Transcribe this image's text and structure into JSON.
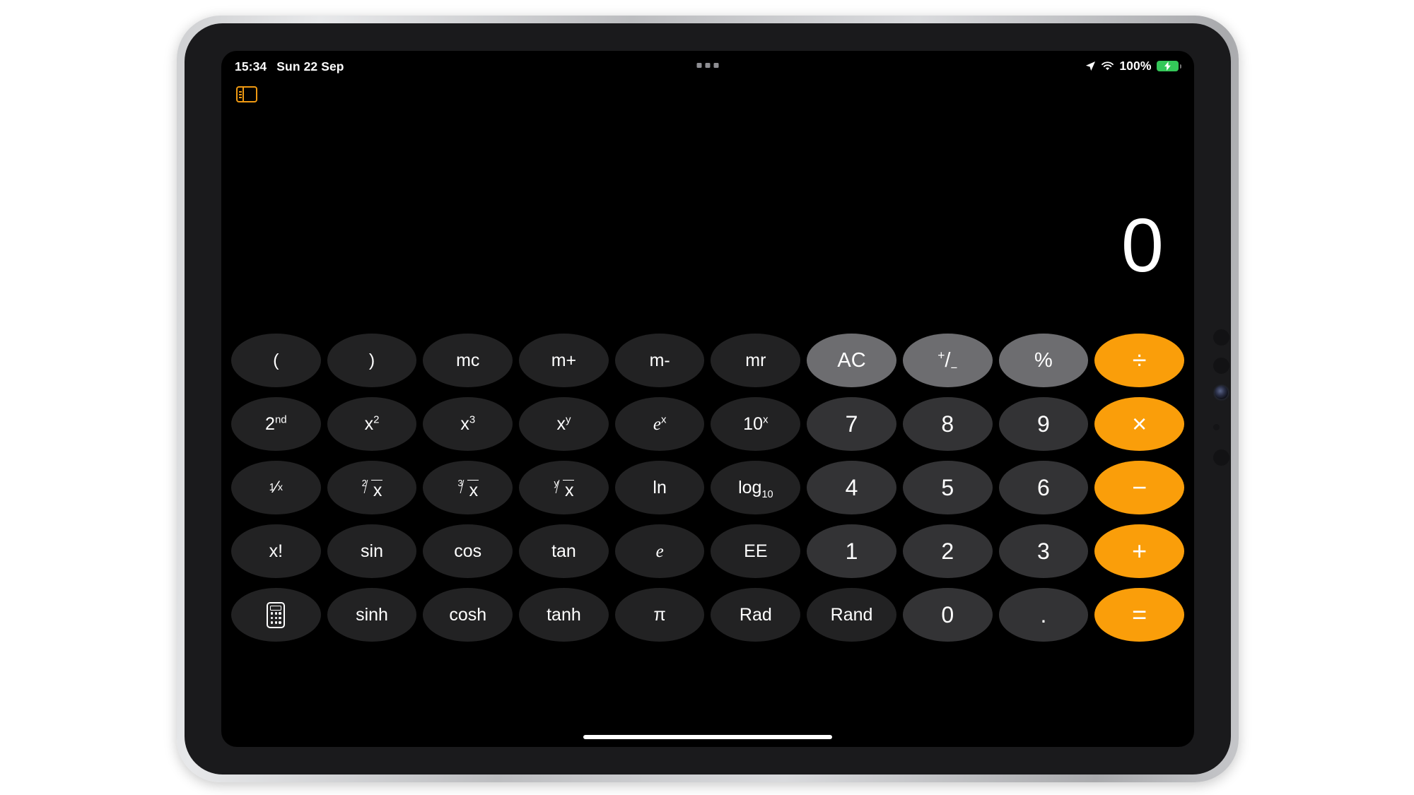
{
  "device": {
    "name": "iPad",
    "frame_color": "#c8c9cc",
    "bezel_color": "#1a1a1c"
  },
  "status_bar": {
    "time": "15:34",
    "date": "Sun 22 Sep",
    "location_icon": "location-arrow-icon",
    "wifi_icon": "wifi-icon",
    "battery_percent": "100%",
    "battery_icon": "battery-charging-icon",
    "battery_color": "#34c759",
    "multitasking_icon": "multitasking-dots-icon"
  },
  "stage_manager": {
    "icon": "sidebar-split-view-icon",
    "color": "#f09a12"
  },
  "app": {
    "name": "Calculator",
    "mode": "scientific",
    "display_value": "0",
    "accent_color": "#fa9e0a",
    "function_key_color": "#222223",
    "number_key_color": "#333335",
    "utility_key_color": "#6d6d70"
  },
  "keypad": {
    "rows": [
      [
        {
          "name": "open-paren",
          "label": "(",
          "kind": "fn",
          "glyph": "text"
        },
        {
          "name": "close-paren",
          "label": ")",
          "kind": "fn",
          "glyph": "text"
        },
        {
          "name": "memory-clear",
          "label": "mc",
          "kind": "fn",
          "glyph": "text"
        },
        {
          "name": "memory-add",
          "label": "m+",
          "kind": "fn",
          "glyph": "text"
        },
        {
          "name": "memory-subtract",
          "label": "m-",
          "kind": "fn",
          "glyph": "text"
        },
        {
          "name": "memory-recall",
          "label": "mr",
          "kind": "fn",
          "glyph": "text"
        },
        {
          "name": "all-clear",
          "label": "AC",
          "kind": "util",
          "glyph": "text"
        },
        {
          "name": "plus-minus",
          "label": "+/-",
          "kind": "util",
          "glyph": "plusminus"
        },
        {
          "name": "percent",
          "label": "%",
          "kind": "util",
          "glyph": "text"
        },
        {
          "name": "divide",
          "label": "÷",
          "kind": "op",
          "glyph": "text"
        }
      ],
      [
        {
          "name": "second-function",
          "label": "2nd",
          "kind": "fn",
          "glyph": "sup",
          "base": "2",
          "exp": "nd"
        },
        {
          "name": "x-squared",
          "label": "x2",
          "kind": "fn",
          "glyph": "sup",
          "base": "x",
          "exp": "2"
        },
        {
          "name": "x-cubed",
          "label": "x3",
          "kind": "fn",
          "glyph": "sup",
          "base": "x",
          "exp": "3"
        },
        {
          "name": "x-to-the-y",
          "label": "xy",
          "kind": "fn",
          "glyph": "sup",
          "base": "x",
          "exp": "y"
        },
        {
          "name": "e-to-the-x",
          "label": "ex",
          "kind": "fn",
          "glyph": "supital",
          "base": "e",
          "exp": "x"
        },
        {
          "name": "ten-to-the-x",
          "label": "10x",
          "kind": "fn",
          "glyph": "sup",
          "base": "10",
          "exp": "x"
        },
        {
          "name": "digit-7",
          "label": "7",
          "kind": "num",
          "glyph": "text"
        },
        {
          "name": "digit-8",
          "label": "8",
          "kind": "num",
          "glyph": "text"
        },
        {
          "name": "digit-9",
          "label": "9",
          "kind": "num",
          "glyph": "text"
        },
        {
          "name": "multiply",
          "label": "×",
          "kind": "op",
          "glyph": "text"
        }
      ],
      [
        {
          "name": "reciprocal",
          "label": "1/x",
          "kind": "fn",
          "glyph": "recip"
        },
        {
          "name": "square-root",
          "label": "2√x",
          "kind": "fn",
          "glyph": "radical",
          "idx": "2",
          "arg": "x"
        },
        {
          "name": "cube-root",
          "label": "3√x",
          "kind": "fn",
          "glyph": "radical",
          "idx": "3",
          "arg": "x"
        },
        {
          "name": "y-root-x",
          "label": "y√x",
          "kind": "fn",
          "glyph": "radical",
          "idx": "y",
          "arg": "x"
        },
        {
          "name": "natural-log",
          "label": "ln",
          "kind": "fn",
          "glyph": "text"
        },
        {
          "name": "log-base-10",
          "label": "log10",
          "kind": "fn",
          "glyph": "sub",
          "base": "log",
          "idx": "10"
        },
        {
          "name": "digit-4",
          "label": "4",
          "kind": "num",
          "glyph": "text"
        },
        {
          "name": "digit-5",
          "label": "5",
          "kind": "num",
          "glyph": "text"
        },
        {
          "name": "digit-6",
          "label": "6",
          "kind": "num",
          "glyph": "text"
        },
        {
          "name": "subtract",
          "label": "−",
          "kind": "op",
          "glyph": "text"
        }
      ],
      [
        {
          "name": "factorial",
          "label": "x!",
          "kind": "fn",
          "glyph": "text"
        },
        {
          "name": "sine",
          "label": "sin",
          "kind": "fn",
          "glyph": "text"
        },
        {
          "name": "cosine",
          "label": "cos",
          "kind": "fn",
          "glyph": "text"
        },
        {
          "name": "tangent",
          "label": "tan",
          "kind": "fn",
          "glyph": "text"
        },
        {
          "name": "euler-number",
          "label": "e",
          "kind": "fn",
          "glyph": "ital"
        },
        {
          "name": "exponent-ee",
          "label": "EE",
          "kind": "fn",
          "glyph": "text"
        },
        {
          "name": "digit-1",
          "label": "1",
          "kind": "num",
          "glyph": "text"
        },
        {
          "name": "digit-2",
          "label": "2",
          "kind": "num",
          "glyph": "text"
        },
        {
          "name": "digit-3",
          "label": "3",
          "kind": "num",
          "glyph": "text"
        },
        {
          "name": "add",
          "label": "+",
          "kind": "op",
          "glyph": "text"
        }
      ],
      [
        {
          "name": "basic-calculator-mode",
          "label": "calculator",
          "kind": "fn",
          "glyph": "calcicon"
        },
        {
          "name": "hyperbolic-sine",
          "label": "sinh",
          "kind": "fn",
          "glyph": "text"
        },
        {
          "name": "hyperbolic-cosine",
          "label": "cosh",
          "kind": "fn",
          "glyph": "text"
        },
        {
          "name": "hyperbolic-tangent",
          "label": "tanh",
          "kind": "fn",
          "glyph": "text"
        },
        {
          "name": "pi",
          "label": "π",
          "kind": "fn",
          "glyph": "text"
        },
        {
          "name": "radians-toggle",
          "label": "Rad",
          "kind": "fn",
          "glyph": "text"
        },
        {
          "name": "random",
          "label": "Rand",
          "kind": "fn",
          "glyph": "text"
        },
        {
          "name": "digit-0",
          "label": "0",
          "kind": "num",
          "glyph": "text"
        },
        {
          "name": "decimal-point",
          "label": ".",
          "kind": "num",
          "glyph": "text"
        },
        {
          "name": "equals",
          "label": "=",
          "kind": "op",
          "glyph": "text"
        }
      ]
    ]
  },
  "home_indicator": {
    "name": "home-indicator"
  }
}
